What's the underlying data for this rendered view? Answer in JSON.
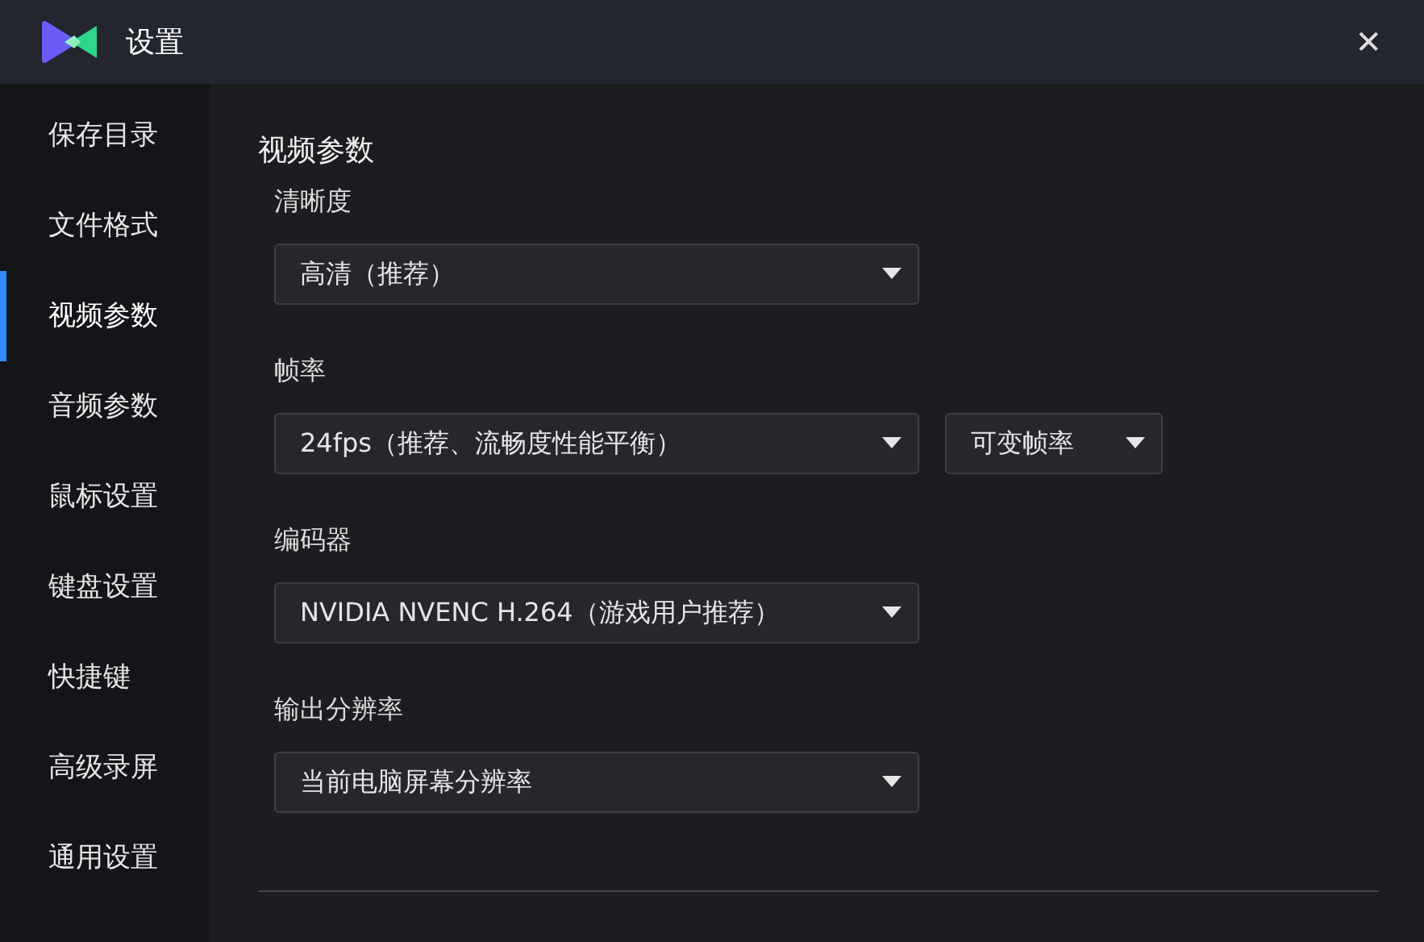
{
  "window": {
    "title": "设置",
    "close": "✕"
  },
  "sidebar": {
    "items": [
      {
        "label": "保存目录",
        "selected": false
      },
      {
        "label": "文件格式",
        "selected": false
      },
      {
        "label": "视频参数",
        "selected": true
      },
      {
        "label": "音频参数",
        "selected": false
      },
      {
        "label": "鼠标设置",
        "selected": false
      },
      {
        "label": "键盘设置",
        "selected": false
      },
      {
        "label": "快捷键",
        "selected": false
      },
      {
        "label": "高级录屏",
        "selected": false
      },
      {
        "label": "通用设置",
        "selected": false
      }
    ]
  },
  "section": {
    "title": "视频参数",
    "fields": [
      {
        "label": "清晰度",
        "dropdowns": [
          {
            "value": "高清（推荐）"
          }
        ]
      },
      {
        "label": "帧率",
        "dropdowns": [
          {
            "value": "24fps（推荐、流畅度性能平衡）"
          },
          {
            "value": "可变帧率"
          }
        ]
      },
      {
        "label": "编码器",
        "dropdowns": [
          {
            "value": "NVIDIA NVENC H.264（游戏用户推荐）"
          }
        ]
      },
      {
        "label": "输出分辨率",
        "dropdowns": [
          {
            "value": "当前电脑屏幕分辨率"
          }
        ]
      }
    ]
  }
}
